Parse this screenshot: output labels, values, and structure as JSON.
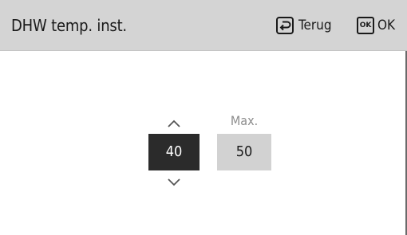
{
  "header": {
    "title": "DHW temp. inst.",
    "back_label": "Terug",
    "ok_icon_text": "OK",
    "ok_label": "OK"
  },
  "setting": {
    "value": "40",
    "max_label": "Max.",
    "max_value": "50"
  }
}
